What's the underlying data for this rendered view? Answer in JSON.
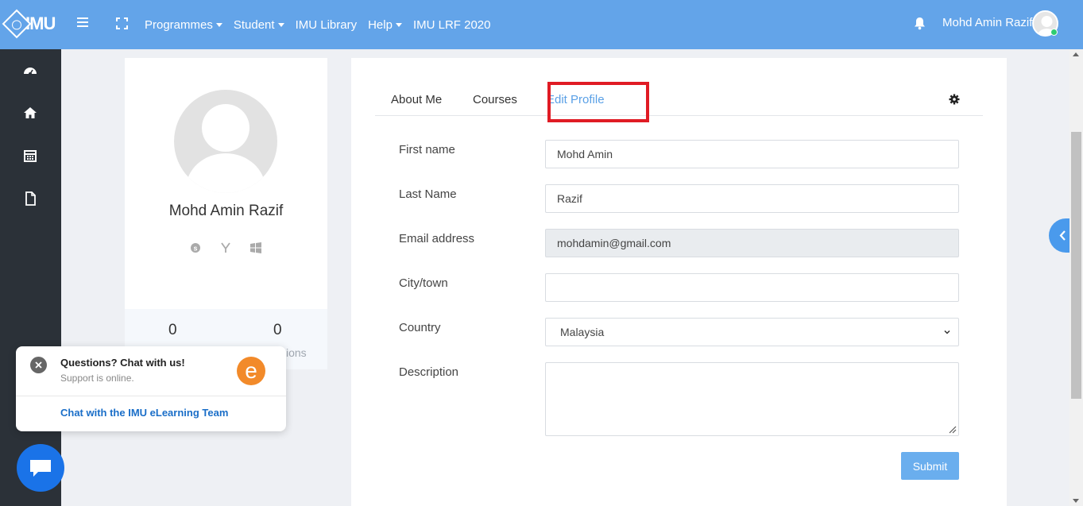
{
  "topbar": {
    "logo_text": "IMU",
    "nav": [
      {
        "label": "Programmes",
        "has_dropdown": true
      },
      {
        "label": "Student",
        "has_dropdown": true
      },
      {
        "label": "IMU Library",
        "has_dropdown": false
      },
      {
        "label": "Help",
        "has_dropdown": true
      },
      {
        "label": "IMU LRF 2020",
        "has_dropdown": false
      }
    ],
    "user_name": "Mohd Amin Razif"
  },
  "sidebar": {
    "icons": [
      "dashboard-icon",
      "home-icon",
      "calendar-icon",
      "file-icon"
    ]
  },
  "profile": {
    "name": "Mohd Amin Razif",
    "social_icons": [
      "skype-icon",
      "yahoo-icon",
      "windows-icon"
    ],
    "stats": [
      {
        "value": "0",
        "label": ""
      },
      {
        "value": "0",
        "label": "sions"
      }
    ]
  },
  "tabs": {
    "items": [
      "About Me",
      "Courses",
      "Edit Profile"
    ],
    "active": "Edit Profile"
  },
  "form": {
    "first_name_label": "First name",
    "first_name_value": "Mohd Amin",
    "last_name_label": "Last Name",
    "last_name_value": "Razif",
    "email_label": "Email address",
    "email_value": "mohdamin@gmail.com",
    "city_label": "City/town",
    "city_value": "",
    "country_label": "Country",
    "country_value": "Malaysia",
    "description_label": "Description",
    "submit_label": "Submit"
  },
  "chat": {
    "title": "Questions? Chat with us!",
    "status": "Support is online.",
    "logo_letter": "e",
    "link": "Chat with the IMU eLearning Team"
  },
  "colors": {
    "topbar": "#63a4e9",
    "sidebar": "#2b3138",
    "accent": "#5aa0e6",
    "highlight": "#e01b24",
    "chat_button": "#1a73e8",
    "chat_logo": "#f28a2a"
  }
}
